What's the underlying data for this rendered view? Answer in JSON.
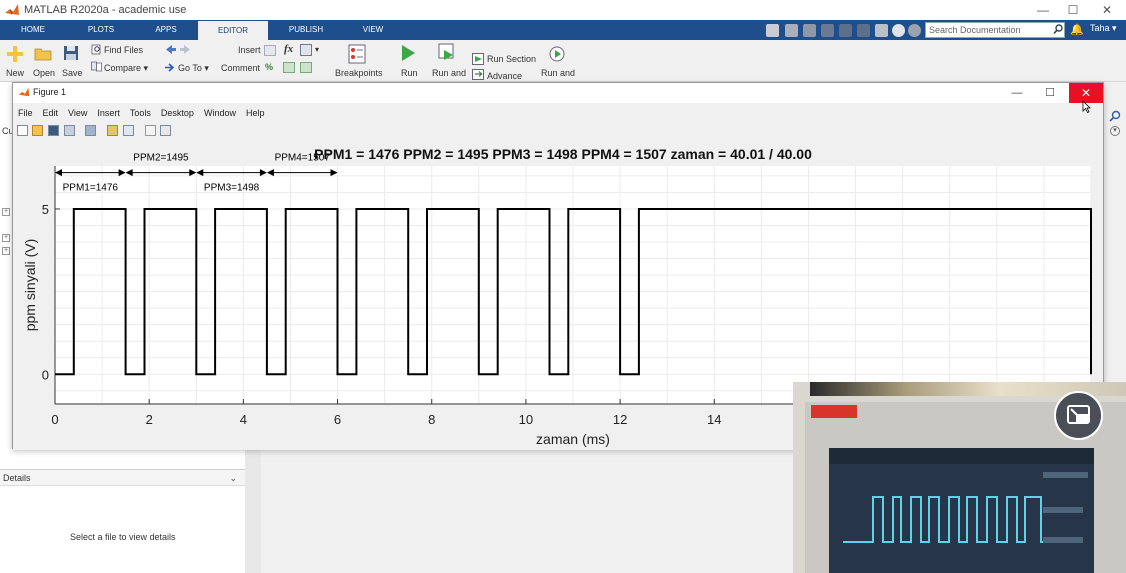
{
  "window": {
    "title": "MATLAB R2020a - academic use",
    "minimize": "—",
    "maximize": "☐",
    "close": "✕"
  },
  "tabs": [
    {
      "label": "HOME"
    },
    {
      "label": "PLOTS"
    },
    {
      "label": "APPS"
    },
    {
      "label": "EDITOR"
    },
    {
      "label": "PUBLISH"
    },
    {
      "label": "VIEW"
    }
  ],
  "search": {
    "placeholder": "Search Documentation"
  },
  "user": {
    "name": "Taha ▾"
  },
  "toolstrip": {
    "new": "New",
    "open": "Open",
    "save": "Save",
    "find_files": "Find Files",
    "compare": "Compare ▾",
    "go_to": "Go To ▾",
    "insert": "Insert",
    "comment": "Comment",
    "breakpoints": "Breakpoints",
    "run": "Run",
    "run_and_advance": "Run and",
    "run_section": "Run Section",
    "advance": "Advance",
    "run_and_time": "Run and",
    "fx": "fx",
    "percent": "%"
  },
  "figure": {
    "title": "Figure 1",
    "menu": [
      "File",
      "Edit",
      "View",
      "Insert",
      "Tools",
      "Desktop",
      "Window",
      "Help"
    ]
  },
  "details": {
    "header": "Details",
    "message": "Select a file to view details"
  },
  "left_panel": {
    "cut_label": "Cu"
  },
  "colors": {
    "tabstrip": "#1f4e8c",
    "close_red": "#e81123",
    "signal": "#000000"
  },
  "chart_data": {
    "type": "line",
    "title": "PPM1 = 1476  PPM2 = 1495  PPM3 = 1498  PPM4 = 1507  zaman = 40.01 / 40.00",
    "xlabel": "zaman (ms)",
    "ylabel": "ppm sinyali (V)",
    "xlim": [
      0,
      22
    ],
    "ylim": [
      -0.9,
      6.3
    ],
    "xticks": [
      "0",
      "2",
      "4",
      "6",
      "8",
      "10",
      "12",
      "14"
    ],
    "yticks": [
      "0",
      "5"
    ],
    "grid": true,
    "series": [
      {
        "x": [
          0,
          0.4,
          0.4,
          1.5,
          1.5,
          1.9,
          1.9,
          3.0,
          3.0,
          3.4,
          3.4,
          4.5,
          4.5,
          4.9,
          4.9,
          6.0,
          6.0,
          6.4,
          6.4,
          7.5,
          7.5,
          7.9,
          7.9,
          9.0,
          9.0,
          9.4,
          9.4,
          10.5,
          10.5,
          10.9,
          10.9,
          12.0,
          12.0,
          12.4,
          12.4,
          22.0,
          22.0
        ],
        "y": [
          0,
          0,
          5,
          5,
          0,
          0,
          5,
          5,
          0,
          0,
          5,
          5,
          0,
          0,
          5,
          5,
          0,
          0,
          5,
          5,
          0,
          0,
          5,
          5,
          0,
          0,
          5,
          5,
          0,
          0,
          5,
          5,
          0,
          0,
          5,
          5,
          0
        ]
      }
    ],
    "annotations": [
      {
        "text": "PPM1=1476",
        "x_from": 0,
        "x_to": 1.5,
        "label_row": "lower"
      },
      {
        "text": "PPM2=1495",
        "x_from": 1.5,
        "x_to": 3.0,
        "label_row": "upper"
      },
      {
        "text": "PPM3=1498",
        "x_from": 3.0,
        "x_to": 4.5,
        "label_row": "lower"
      },
      {
        "text": "PPM4=1507",
        "x_from": 4.5,
        "x_to": 6.0,
        "label_row": "upper"
      }
    ]
  }
}
